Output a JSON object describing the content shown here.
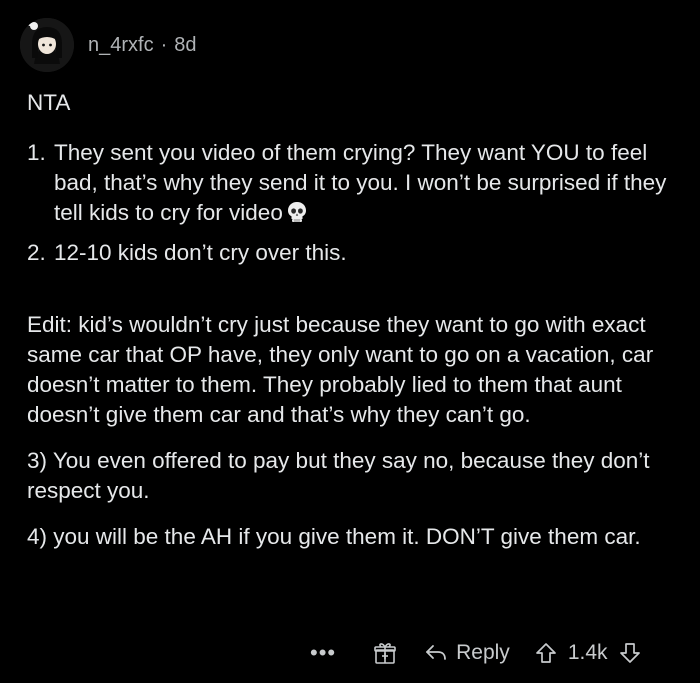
{
  "comment": {
    "username": "n_4rxfc",
    "separator": "·",
    "age": "8d",
    "opening": "NTA",
    "list": [
      {
        "num": "1.",
        "text": "They sent you video of them crying? They want YOU to feel bad, that’s why they send it to you. I won’t be surprised if they tell kids to cry for video",
        "emoji": "skull-icon"
      },
      {
        "num": "2.",
        "text": "12-10 kids don’t cry over this."
      }
    ],
    "edit": "Edit: kid’s wouldn’t cry just because they want to go with exact same car that OP have, they only want to go on a vacation, car doesn’t matter to them. They probably lied to them that aunt doesn’t give them car and that’s why they can’t go.",
    "point3": "3) You even offered to pay but they say no, because they don’t respect you.",
    "point4": "4) you will be the AH if you give them it. DON’T give them car."
  },
  "actions": {
    "more_label": "•••",
    "reply_label": "Reply",
    "vote_count": "1.4k"
  }
}
